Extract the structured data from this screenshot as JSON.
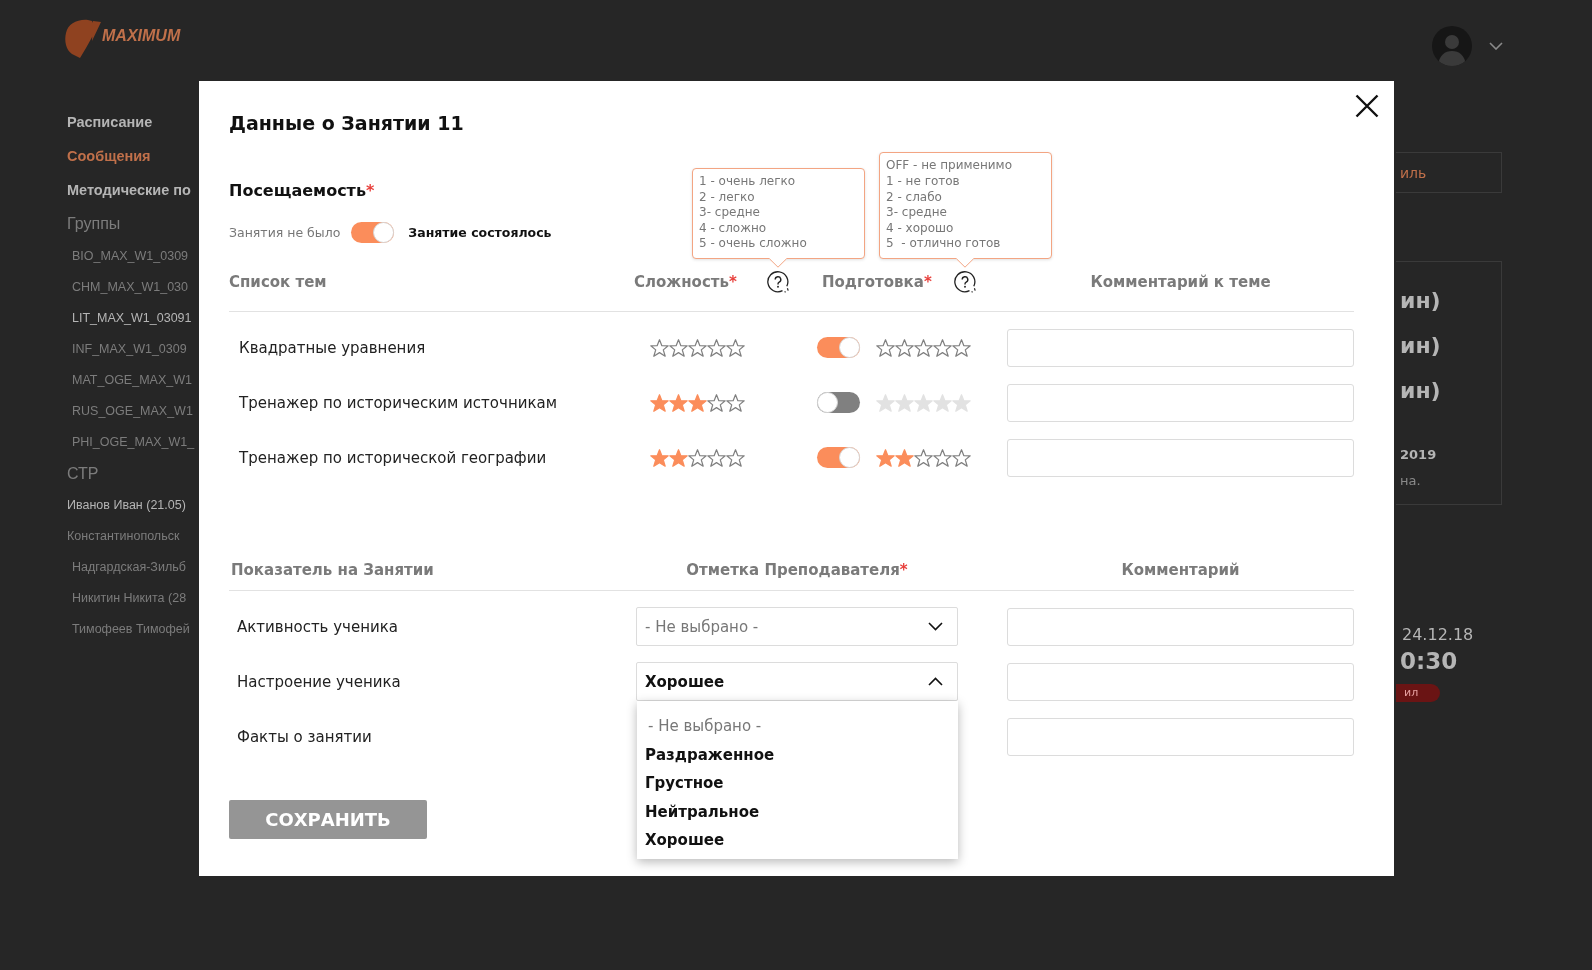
{
  "background": {
    "logo": {
      "text": "MAXIMUM"
    },
    "menu": [
      {
        "label": "Расписание",
        "selected": false
      },
      {
        "label": "Сообщения",
        "selected": true
      },
      {
        "label": "Методические по",
        "selected": false
      }
    ],
    "groups": {
      "title": "Группы",
      "items": [
        {
          "label": "BIO_MAX_W1_0309",
          "selected": false
        },
        {
          "label": "CHM_MAX_W1_030",
          "selected": false
        },
        {
          "label": "LIT_MAX_W1_03091",
          "selected": true
        },
        {
          "label": "INF_MAX_W1_0309",
          "selected": false
        },
        {
          "label": "MAT_OGE_MAX_W1",
          "selected": false
        },
        {
          "label": "RUS_OGE_MAX_W1",
          "selected": false
        },
        {
          "label": "PHI_OGE_MAX_W1_",
          "selected": false
        }
      ]
    },
    "students": {
      "title": "СТР",
      "items": [
        {
          "label": "Иванов Иван (21.05)",
          "selected": true
        },
        {
          "label": "Константинопольск",
          "selected": false,
          "children": [
            {
              "label": "Надгардская-Зильб",
              "selected": false
            },
            {
              "label": "Никитин Никита (28",
              "selected": false
            },
            {
              "label": "Тимофеев Тимофей",
              "selected": false
            }
          ]
        }
      ]
    },
    "right_panel": {
      "button": "иль",
      "card_lines": [
        {
          "text": "ин)",
          "kind": "heading"
        },
        {
          "text": "ин)",
          "kind": "heading"
        },
        {
          "text": "ин)",
          "kind": "heading"
        },
        {
          "text": "2019",
          "kind": "date"
        },
        {
          "text": "на.",
          "kind": "note"
        }
      ],
      "date": "24.12.18",
      "time": "0:30",
      "badge": "ил"
    }
  },
  "modal": {
    "title": "Данные о Занятии 11",
    "attendance": {
      "label": "Посещаемость",
      "required_mark": "*",
      "off_label": "Занятия не было",
      "on_label": "Занятие состоялось",
      "on": true
    },
    "topics": {
      "columns": [
        {
          "label": "Список тем"
        },
        {
          "label": "Сложность",
          "required_mark": "*",
          "tooltip": [
            "1 - очень легко",
            "2 - легко",
            "3- средне",
            "4 - сложно",
            "5 - очень сложно"
          ]
        },
        {
          "label": "Подготовка",
          "required_mark": "*",
          "tooltip": [
            "OFF - не применимо",
            "1 - не готов",
            "2 - слабо",
            "3- средне",
            "4 - хорошо",
            "5  - отлично готов"
          ]
        },
        {
          "label": "Комментарий к теме"
        }
      ],
      "rows": [
        {
          "topic": "Квадратные уравнения",
          "difficulty": {
            "stars": 0
          },
          "preparation": {
            "on": true,
            "stars": 0
          }
        },
        {
          "topic": "Тренажер по историческим источникам",
          "difficulty": {
            "stars": 3
          },
          "preparation": {
            "on": false,
            "stars": 0
          }
        },
        {
          "topic": "Тренажер по исторической географии",
          "difficulty": {
            "stars": 2
          },
          "preparation": {
            "on": true,
            "stars": 2
          }
        }
      ]
    },
    "indicators": {
      "columns": [
        {
          "label": "Показатель на Занятии"
        },
        {
          "label": "Отметка Преподавателя",
          "required_mark": "*"
        },
        {
          "label": "Комментарий"
        }
      ],
      "rows": [
        {
          "label": "Активность ученика",
          "select": {
            "placeholder": "- Не выбрано -",
            "expanded": false
          }
        },
        {
          "label": "Настроение ученика",
          "select": {
            "value": "Хорошее",
            "expanded": true,
            "options": [
              {
                "label": "- Не выбрано -",
                "kind": "placeholder"
              },
              {
                "label": "Раздраженное",
                "kind": "option"
              },
              {
                "label": "Грустное",
                "kind": "option"
              },
              {
                "label": "Нейтральное",
                "kind": "option"
              },
              {
                "label": "Хорошее",
                "kind": "option"
              }
            ]
          }
        },
        {
          "label": "Факты о занятии"
        }
      ]
    },
    "save_button": {
      "label": "СОХРАНИТЬ",
      "disabled": true
    }
  }
}
